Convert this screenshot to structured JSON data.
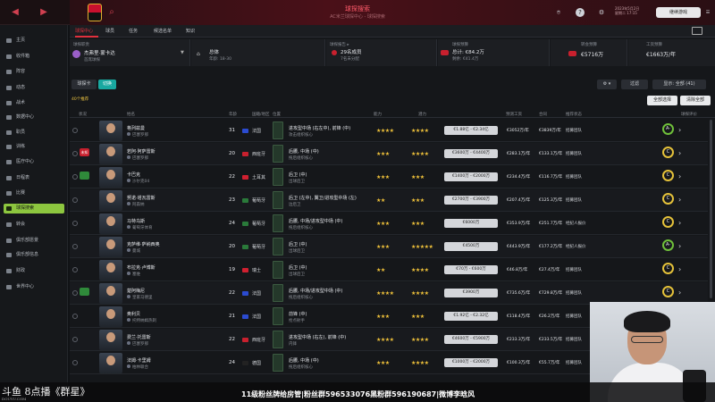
{
  "topbar": {
    "title": "球探搜索",
    "subtitle": "AC米兰球探中心 - 球探搜索",
    "date_line1": "2023年5月2日",
    "date_line2": "星期二 17:15",
    "continue_label": "继续游戏",
    "help_icon": "?"
  },
  "sidebar": {
    "items": [
      {
        "label": "主页"
      },
      {
        "label": "收件箱"
      },
      {
        "label": "阵容"
      },
      {
        "label": "动态"
      },
      {
        "label": "战术"
      },
      {
        "label": "数据中心"
      },
      {
        "label": "职员"
      },
      {
        "label": "训练"
      },
      {
        "label": "医疗中心"
      },
      {
        "label": "日程表"
      },
      {
        "label": "比赛"
      },
      {
        "label": "球探搜索"
      },
      {
        "label": "转会"
      },
      {
        "label": "俱乐部愿景"
      },
      {
        "label": "俱乐部信息"
      },
      {
        "label": "财政"
      },
      {
        "label": "世界中心"
      }
    ]
  },
  "tabs": [
    {
      "label": "球探中心"
    },
    {
      "label": "球员"
    },
    {
      "label": "任务"
    },
    {
      "label": "候选名单"
    },
    {
      "label": "知识"
    }
  ],
  "panels": {
    "scout": {
      "label": "球探职责",
      "name": "杰弗里·蒙卡达",
      "sub": "首席球探"
    },
    "region": {
      "label": "",
      "value": "总体",
      "sub": "年龄: 18-30"
    },
    "reports": {
      "label": "球探报告 ▸",
      "value": "29名成员",
      "sub": "7名未分配"
    },
    "budget": {
      "label": "球探预算",
      "value": "总计: €84.2万",
      "sub": "剩余: €41.4万"
    },
    "transfer": {
      "label": "转会预算",
      "value": "€5716万"
    },
    "wage": {
      "label": "工资预算",
      "value": "€1663万/年"
    }
  },
  "toolbar": {
    "player_card": "球探卡",
    "toggle": "切换",
    "filter": "过滤",
    "display": "显示: 全部 (41)",
    "select_all": "全部选择",
    "clear": "清除全部"
  },
  "count_label": "40个推荐",
  "columns": [
    "状况",
    "姓名",
    "年龄",
    "国籍/地区",
    "位置",
    "能力",
    "潜力",
    "预测工资",
    "合同",
    "推荐状态",
    "球探评价"
  ],
  "rows": [
    {
      "tag": "",
      "name": "格列兹曼",
      "club": "巴塞罗那",
      "age": "31",
      "nat": "法国",
      "flag": "#2b4bd0",
      "pos1": "进攻型中场 (右左中), 前锋 (中)",
      "pos2": "攻击组织核心",
      "ab": "★★★★",
      "abe": "",
      "po": "★★★★",
      "poe": "",
      "value": "€1.88亿 - €2.34亿",
      "wage": "€3052万/年",
      "contract": "€3839万/年",
      "status": "招募团队",
      "grade": "A-",
      "g": true,
      "tagc": ""
    },
    {
      "tag": "未知",
      "name": "若阿·阿萨雷斯",
      "club": "巴塞罗那",
      "age": "20",
      "nat": "西班牙",
      "flag": "#c8202e",
      "pos1": "后腰, 中场 (中)",
      "pos2": "拖后组织核心",
      "ab": "★★★",
      "abe": "★",
      "po": "★★★★",
      "poe": "",
      "value": "€3600万 - €4400万",
      "wage": "€283.1万/年",
      "contract": "€133.1万/年",
      "status": "招募团队",
      "grade": "C",
      "g": false,
      "tagc": "#c8202e"
    },
    {
      "tag": "",
      "name": "卡巴克",
      "club": "沙尔克04",
      "age": "22",
      "nat": "土耳其",
      "flag": "#d02030",
      "pos1": "后卫 (中)",
      "pos2": "出球后卫",
      "ab": "★★★",
      "abe": "",
      "po": "★★★",
      "poe": "",
      "value": "€1400万 - €2000万",
      "wage": "€234.4万/年",
      "contract": "€116.7万/年",
      "status": "招募团队",
      "grade": "C",
      "g": false,
      "tagc": "#2f8a3a"
    },
    {
      "tag": "",
      "name": "努诺·塔瓦雷斯",
      "club": "阿森纳",
      "age": "23",
      "nat": "葡萄牙",
      "flag": "#2a7a3a",
      "pos1": "后卫 (左中), 翼卫/进攻型中场 (左)",
      "pos2": "边后卫",
      "ab": "★★",
      "abe": "",
      "po": "★★★",
      "poe": "",
      "value": "€2700万 - €3900万",
      "wage": "€207.4万/年",
      "contract": "€125.3万/年",
      "status": "招募团队",
      "grade": "C",
      "g": false,
      "tagc": ""
    },
    {
      "tag": "",
      "name": "马特乌斯",
      "club": "葡萄牙体育",
      "age": "24",
      "nat": "葡萄牙",
      "flag": "#2a7a3a",
      "pos1": "后腰, 中场/进攻型中场 (中)",
      "pos2": "拖后组织核心",
      "ab": "★★★",
      "abe": "",
      "po": "★★★",
      "poe": "",
      "value": "€6000万",
      "wage": "€353.9万/年",
      "contract": "€251.7万/年",
      "status": "经纪人报价",
      "grade": "C",
      "g": false,
      "tagc": ""
    },
    {
      "tag": "",
      "name": "克萨维·萨纳西奥",
      "club": "曼城",
      "age": "20",
      "nat": "葡萄牙",
      "flag": "#2a7a3a",
      "pos1": "后卫 (中)",
      "pos2": "出球后卫",
      "ab": "★★★",
      "abe": "",
      "po": "★★★★★",
      "poe": "",
      "value": "€4500万",
      "wage": "€443.9万/年",
      "contract": "€177.2万/年",
      "status": "经纪人报价",
      "grade": "A-",
      "g": true,
      "tagc": ""
    },
    {
      "tag": "",
      "name": "布拉克·卢博斯",
      "club": "塞维",
      "age": "19",
      "nat": "瑞士",
      "flag": "#d02030",
      "pos1": "后卫 (中)",
      "pos2": "出球后卫",
      "ab": "★★",
      "abe": "",
      "po": "★★★★",
      "poe": "",
      "value": "€70万 - €600万",
      "wage": "€46.8万/年",
      "contract": "€27.4万/年",
      "status": "招募团队",
      "grade": "C",
      "g": false,
      "tagc": ""
    },
    {
      "tag": "",
      "name": "楚阿梅尼",
      "club": "皇家马德里",
      "age": "22",
      "nat": "法国",
      "flag": "#2b4bd0",
      "pos1": "后腰, 中场/进攻型中场 (中)",
      "pos2": "拖后组织核心",
      "ab": "★★★★",
      "abe": "",
      "po": "★★★★",
      "poe": "",
      "value": "€3900万",
      "wage": "€735.6万/年",
      "contract": "€729.8万/年",
      "status": "招募团队",
      "grade": "C",
      "g": false,
      "tagc": "#2f8a3a"
    },
    {
      "tag": "",
      "name": "奥利贝",
      "club": "托特纳姆热刺",
      "age": "21",
      "nat": "法国",
      "flag": "#2b4bd0",
      "pos1": "前锋 (中)",
      "pos2": "抢点射手",
      "ab": "★★★",
      "abe": "",
      "po": "★★★",
      "poe": "",
      "value": "€1.92亿 - €2.32亿",
      "wage": "€118.4万/年",
      "contract": "€26.2万/年",
      "status": "招募团队",
      "grade": "C",
      "g": false,
      "tagc": ""
    },
    {
      "tag": "",
      "name": "费兰·托雷斯",
      "club": "巴塞罗那",
      "age": "22",
      "nat": "西班牙",
      "flag": "#c8202e",
      "pos1": "进攻型中场 (右左), 前锋 (中)",
      "pos2": "内锋",
      "ab": "★★★★",
      "abe": "",
      "po": "★★★★",
      "poe": "",
      "value": "€4600万 - €5900万",
      "wage": "€233.3万/年",
      "contract": "€233.5万/年",
      "status": "招募团队",
      "grade": "C",
      "g": false,
      "tagc": ""
    },
    {
      "tag": "",
      "name": "法姆·卡里姆",
      "club": "柏林联合",
      "age": "24",
      "nat": "德国",
      "flag": "#222222",
      "pos1": "后腰, 中场 (中)",
      "pos2": "拖后组织核心",
      "ab": "★★★",
      "abe": "",
      "po": "★★★★",
      "poe": "",
      "value": "€1000万 - €2000万",
      "wage": "€100.3万/年",
      "contract": "€55.7万/年",
      "status": "招募团队",
      "grade": "C",
      "g": false,
      "tagc": ""
    }
  ],
  "overlay": {
    "watermark": "斗鱼 8点播《群星》",
    "watermark_sub": "DOUYU.COM",
    "banner": "11级粉丝牌给房管|粉丝群596533076黑粉群596190687|微博李晗风"
  }
}
